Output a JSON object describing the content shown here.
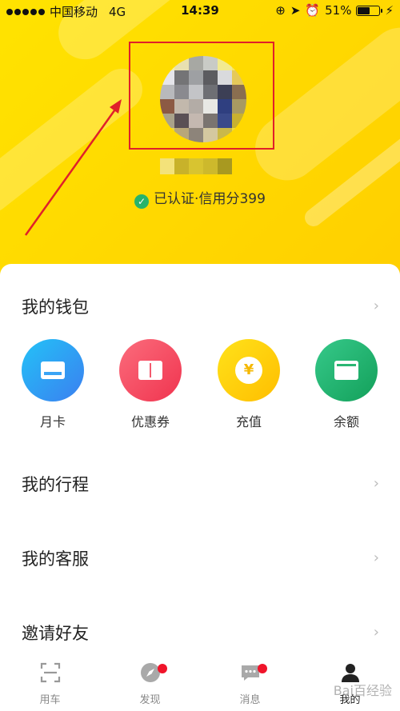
{
  "status_bar": {
    "carrier": "中国移动",
    "network": "4G",
    "time": "14:39",
    "battery": "51%"
  },
  "profile": {
    "verify_text": "已认证·信用分399"
  },
  "menu": {
    "wallet_title": "我的钱包",
    "wallet_items": [
      {
        "label": "月卡",
        "icon": "card-icon",
        "color": "#2f9bf4"
      },
      {
        "label": "优惠券",
        "icon": "coupon-icon",
        "color": "#f44b63"
      },
      {
        "label": "充值",
        "icon": "yen-coin-icon",
        "color": "#ffcc00"
      },
      {
        "label": "余额",
        "icon": "wallet-icon",
        "color": "#22b06a"
      }
    ],
    "trips_title": "我的行程",
    "service_title": "我的客服",
    "invite_title": "邀请好友",
    "chevron": "›"
  },
  "tabbar": {
    "items": [
      {
        "label": "用车",
        "icon": "scan-icon",
        "badge": false
      },
      {
        "label": "发现",
        "icon": "compass-icon",
        "badge": true
      },
      {
        "label": "消息",
        "icon": "message-icon",
        "badge": true
      },
      {
        "label": "我的",
        "icon": "profile-icon",
        "badge": false,
        "active": true
      }
    ]
  },
  "watermark": "Bai百经验",
  "colors": {
    "header_yellow": "#ffdd00",
    "annotation_red": "#e0202a",
    "verified_green": "#27b36b"
  }
}
